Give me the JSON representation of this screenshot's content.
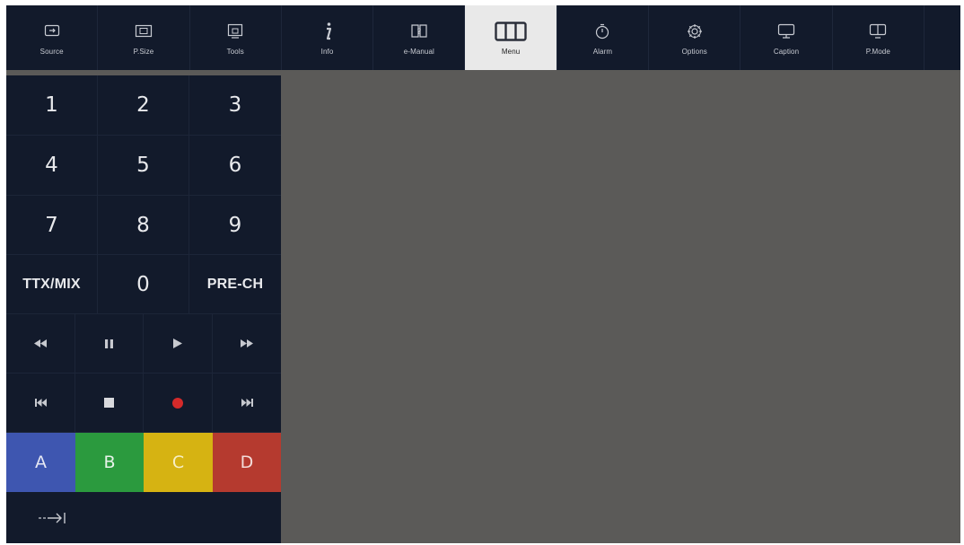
{
  "toolbar": {
    "buttons": [
      {
        "label": "Source",
        "icon": "source-icon"
      },
      {
        "label": "P.Size",
        "icon": "picture-size-icon"
      },
      {
        "label": "Tools",
        "icon": "tools-icon"
      },
      {
        "label": "Info",
        "icon": "info-icon"
      },
      {
        "label": "e-Manual",
        "icon": "e-manual-icon"
      },
      {
        "label": "Menu",
        "icon": "menu-icon"
      },
      {
        "label": "Alarm",
        "icon": "alarm-icon"
      },
      {
        "label": "Options",
        "icon": "options-gear-icon"
      },
      {
        "label": "Caption",
        "icon": "caption-icon"
      },
      {
        "label": "P.Mode",
        "icon": "picture-mode-icon"
      }
    ],
    "active": "Menu"
  },
  "keypad": {
    "k1": "1",
    "k2": "2",
    "k3": "3",
    "k4": "4",
    "k5": "5",
    "k6": "6",
    "k7": "7",
    "k8": "8",
    "k9": "9",
    "ttx": "TTX/MIX",
    "k0": "0",
    "prech": "PRE-CH"
  },
  "media": {
    "row1": [
      "rewind-icon",
      "pause-icon",
      "play-icon",
      "fast-forward-icon"
    ],
    "row2": [
      "skip-back-icon",
      "stop-icon",
      "record-icon",
      "skip-forward-icon"
    ]
  },
  "color_keys": {
    "a": "A",
    "b": "B",
    "c": "C",
    "d": "D",
    "colors": {
      "a": "#3e56b0",
      "b": "#2b9a3e",
      "c": "#d6b312",
      "d": "#b53a2f"
    }
  },
  "bottom": {
    "icon": "move-to-icon"
  },
  "colors": {
    "toolbar_bg": "#121a2b",
    "active_bg": "#e9e9e9",
    "content_bg": "#5b5a58",
    "record": "#d42a2a"
  }
}
